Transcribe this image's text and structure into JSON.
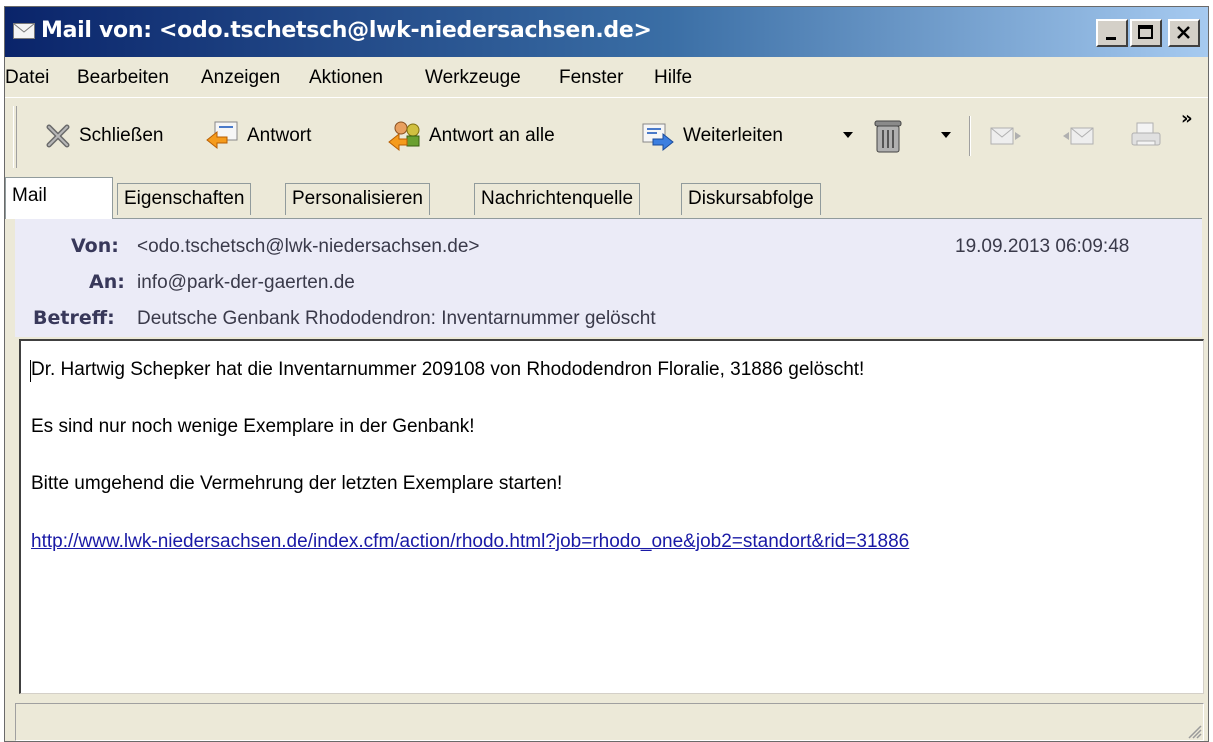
{
  "window": {
    "title": "Mail von: <odo.tschetsch@lwk-niedersachsen.de>",
    "controls": [
      "minimize",
      "maximize",
      "close"
    ]
  },
  "menu": {
    "items": [
      "Datei",
      "Bearbeiten",
      "Anzeigen",
      "Aktionen",
      "Werkzeuge",
      "Fenster",
      "Hilfe"
    ]
  },
  "toolbar": {
    "close_label": "Schließen",
    "reply_label": "Antwort",
    "reply_all_label": "Antwort an alle",
    "forward_label": "Weiterleiten",
    "icons": [
      "close-x-icon",
      "reply-icon",
      "reply-all-icon",
      "forward-icon",
      "trash-can-icon",
      "next-message-icon",
      "previous-message-icon",
      "print-icon"
    ],
    "overflow": "»"
  },
  "tabs": [
    "Mail",
    "Eigenschaften",
    "Personalisieren",
    "Nachrichtenquelle",
    "Diskursabfolge"
  ],
  "header": {
    "from_label": "Von:",
    "from_value": "<odo.tschetsch@lwk-niedersachsen.de>",
    "date": "19.09.2013 06:09:48",
    "to_label": "An:",
    "to_value": "info@park-der-gaerten.de",
    "subject_label": "Betreff:",
    "subject_value": "Deutsche Genbank Rhododendron: Inventarnummer gelöscht"
  },
  "body": {
    "line1": "Dr. Hartwig Schepker hat die Inventarnummer 209108 von Rhododendron  Floralie, 31886 gelöscht!",
    "line2": "Es sind nur noch wenige Exemplare in der Genbank!",
    "line3": "Bitte umgehend die Vermehrung der letzten Exemplare starten!",
    "link": "http://www.lwk-niedersachsen.de/index.cfm/action/rhodo.html?job=rhodo_one&job2=standort&rid=31886"
  },
  "colors": {
    "title_start": "#0a246a",
    "title_end": "#a6caf0",
    "chrome": "#ece9d8",
    "header_bg": "#ebebf7",
    "link": "#1a1aa6"
  }
}
